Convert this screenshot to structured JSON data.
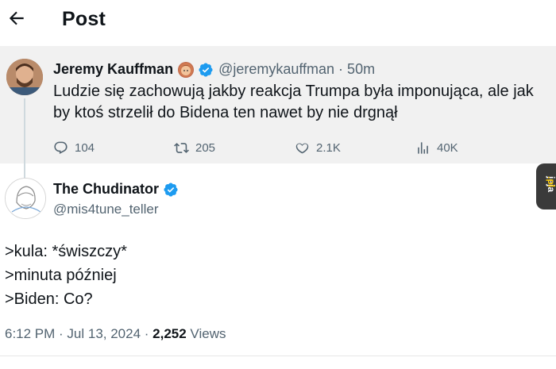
{
  "header": {
    "title": "Post"
  },
  "parent_post": {
    "author_name": "Jeremy Kauffman",
    "handle_time": "@jeremykauffman · 50m",
    "text": "Ludzie się zachowują jakby reakcja Trumpa była imponująca, ale jak by ktoś strzelił do Bidena ten nawet by nie drgnął",
    "replies": "104",
    "reposts": "205",
    "likes": "2.1K",
    "views": "40K"
  },
  "reply_post": {
    "author_name": "The Chudinator",
    "handle": "@mis4tune_teller",
    "lines": [
      ">kula: *świszczy*",
      ">minuta później",
      ">Biden: Co?"
    ],
    "timestamp": "6:12 PM · Jul 13, 2024 · ",
    "views_count": "2,252",
    "views_label": " Views"
  },
  "watermark": {
    "name": "jeja",
    "tld": ".pl"
  },
  "colors": {
    "verified": "#1d9bf0",
    "muted": "#536471",
    "parent_bg": "#f1f1f1"
  }
}
